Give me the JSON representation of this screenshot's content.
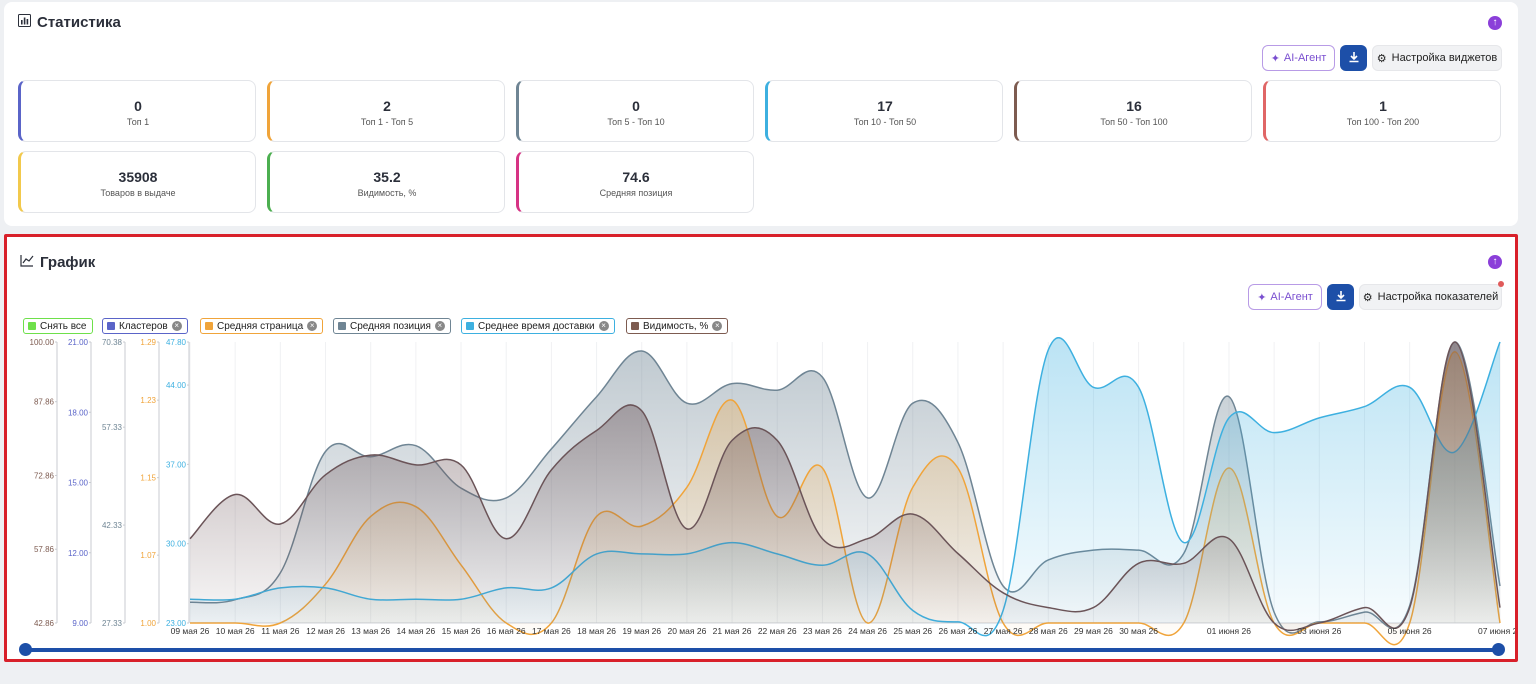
{
  "stats": {
    "title": "Статистика",
    "ai_label": "AI-Агент",
    "settings_label": "Настройка виджетов",
    "tiles": [
      {
        "value": "0",
        "label": "Топ 1",
        "color": "#5a64c8"
      },
      {
        "value": "2",
        "label": "Топ 1 - Топ 5",
        "color": "#f0a43a"
      },
      {
        "value": "0",
        "label": "Топ 5 - Топ 10",
        "color": "#6f8594"
      },
      {
        "value": "17",
        "label": "Топ 10 - Топ 50",
        "color": "#3db0e0"
      },
      {
        "value": "16",
        "label": "Топ 50 - Топ 100",
        "color": "#7d5b50"
      },
      {
        "value": "1",
        "label": "Топ 100 - Топ 200",
        "color": "#e06666"
      },
      {
        "value": "35908",
        "label": "Товаров в выдаче",
        "color": "#f2c94c"
      },
      {
        "value": "35.2",
        "label": "Видимость, %",
        "color": "#4caf50"
      },
      {
        "value": "74.6",
        "label": "Средняя позиция",
        "color": "#d63384"
      }
    ]
  },
  "chart_section": {
    "title": "График",
    "ai_label": "AI-Агент",
    "settings_label": "Настройка показателей",
    "legend": [
      {
        "label": "Снять все",
        "color": "#6ee04a",
        "removable": false
      },
      {
        "label": "Кластеров",
        "color": "#5a64c8",
        "removable": true
      },
      {
        "label": "Средняя страница",
        "color": "#f0a43a",
        "removable": true
      },
      {
        "label": "Средняя позиция",
        "color": "#6f8594",
        "removable": true
      },
      {
        "label": "Среднее время доставки",
        "color": "#3db0e0",
        "removable": true
      },
      {
        "label": "Видимость, %",
        "color": "#7d5b50",
        "removable": true
      }
    ]
  },
  "chart_data": {
    "type": "area",
    "x": [
      "09 мая 26",
      "10 мая 26",
      "11 мая 26",
      "12 мая 26",
      "13 мая 26",
      "14 мая 26",
      "15 мая 26",
      "16 мая 26",
      "17 мая 26",
      "18 мая 26",
      "19 мая 26",
      "20 мая 26",
      "21 мая 26",
      "22 мая 26",
      "23 мая 26",
      "24 мая 26",
      "25 мая 26",
      "26 мая 26",
      "27 мая 26",
      "28 мая 26",
      "29 мая 26",
      "30 мая 26",
      "31 мая 26",
      "01 июня 26",
      "02 июня 26",
      "03 июня 26",
      "04 июня 26",
      "05 июня 26",
      "06 июня 26",
      "07 июня 26"
    ],
    "x_tick_labels": [
      "09 мая 26",
      "10 мая 26",
      "11 мая 26",
      "12 мая 26",
      "13 мая 26",
      "14 мая 26",
      "15 мая 26",
      "16 мая 26",
      "17 мая 26",
      "18 мая 26",
      "19 мая 26",
      "20 мая 26",
      "21 мая 26",
      "22 мая 26",
      "23 мая 26",
      "24 мая 26",
      "25 мая 26",
      "26 мая 26",
      "27 мая 26",
      "28 мая 26",
      "29 мая 26",
      "30 мая 26",
      "",
      "01 июня 26",
      "",
      "03 июня 26",
      "",
      "05 июня 26",
      "",
      "07 июня 26"
    ],
    "axes": [
      {
        "id": "visibility",
        "ticks": [
          "100.00",
          "87.86",
          "72.86",
          "57.86",
          "42.86"
        ],
        "min": 42.86,
        "max": 100,
        "color": "#7d5b50"
      },
      {
        "id": "clusters",
        "ticks": [
          "21.00",
          "18.00",
          "15.00",
          "12.00",
          "9.00"
        ],
        "min": 9,
        "max": 21,
        "color": "#5a64c8"
      },
      {
        "id": "avg_position",
        "ticks": [
          "70.38",
          "57.33",
          "42.33",
          "27.33"
        ],
        "min": 27.33,
        "max": 70.38,
        "color": "#6f8594"
      },
      {
        "id": "avg_page",
        "ticks": [
          "1.29",
          "1.23",
          "1.15",
          "1.07",
          "1.00"
        ],
        "min": 1.0,
        "max": 1.29,
        "color": "#f0a43a"
      },
      {
        "id": "delivery",
        "ticks": [
          "47.80",
          "44.00",
          "37.00",
          "30.00",
          "23.00"
        ],
        "min": 23.0,
        "max": 47.8,
        "color": "#3db0e0"
      }
    ],
    "series": [
      {
        "name": "Средняя позиция",
        "axis": "avg_position",
        "color": "#6f8594",
        "values": [
          30.5,
          30.9,
          35,
          53.6,
          52.8,
          54.5,
          48,
          46.5,
          54,
          62,
          69,
          61,
          64,
          63,
          65,
          46.5,
          61,
          55,
          33,
          37,
          38.5,
          38.5,
          38,
          62,
          29,
          27.5,
          29,
          30,
          70.4,
          33
        ]
      },
      {
        "name": "Средняя страница",
        "axis": "avg_page",
        "color": "#f0a43a",
        "values": [
          1.0,
          1.0,
          1.0,
          1.04,
          1.11,
          1.12,
          1.06,
          1.0,
          1.0,
          1.11,
          1.1,
          1.14,
          1.23,
          1.11,
          1.16,
          1.0,
          1.14,
          1.16,
          1.0,
          1.0,
          1.0,
          1.0,
          1.0,
          1.16,
          1.0,
          1.0,
          1.0,
          1.0,
          1.28,
          1.0
        ]
      },
      {
        "name": "Среднее время доставки",
        "axis": "delivery",
        "color": "#3db0e0",
        "values": [
          25.1,
          25.1,
          26.1,
          26.1,
          25.1,
          25.1,
          25.1,
          26.1,
          26.1,
          29.1,
          29.1,
          29.1,
          30.1,
          29.1,
          28.1,
          29.1,
          24.1,
          23.1,
          24.1,
          47.1,
          43.8,
          43.8,
          30.1,
          41.1,
          39.8,
          41.1,
          42.1,
          43.8,
          38.1,
          47.8
        ]
      },
      {
        "name": "Видимость, %",
        "axis": "visibility",
        "color": "#6b5458",
        "values": [
          60,
          69,
          63,
          73,
          77,
          75,
          75,
          60,
          74,
          82,
          86,
          62,
          80,
          80,
          60,
          60,
          65,
          57,
          49,
          46,
          46,
          55,
          55,
          60,
          42.86,
          42.86,
          46,
          46,
          100,
          46
        ]
      }
    ],
    "grid": true,
    "legend_placement": "top-left",
    "has_range_slider": true
  }
}
